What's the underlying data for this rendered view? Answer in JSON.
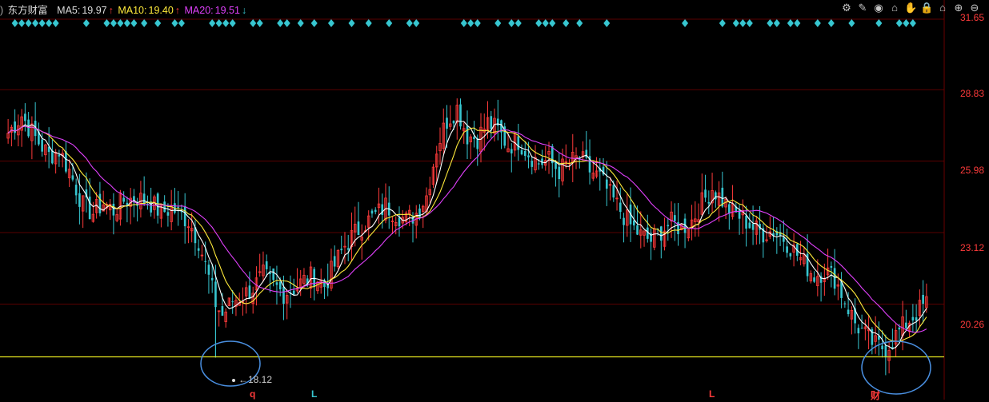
{
  "header": {
    "stock_name": "东方财富",
    "ma5_label": "MA5:",
    "ma5_value": "19.97",
    "ma5_arrow": "↑",
    "ma10_label": "MA10:",
    "ma10_value": "19.40",
    "ma10_arrow": "↑",
    "ma20_label": "MA20:",
    "ma20_value": "19.51",
    "ma20_arrow": "↓"
  },
  "toolbar": {
    "icons": [
      "gear-icon",
      "pencil-icon",
      "eye-icon",
      "basket-icon",
      "hand-icon",
      "lock-icon",
      "home-icon",
      "zoom-in-icon",
      "zoom-out-icon"
    ],
    "glyphs": [
      "⚙",
      "✎",
      "◉",
      "⌂",
      "✋",
      "🔒",
      "⌂",
      "⊕",
      "⊖"
    ]
  },
  "colors": {
    "background": "#000000",
    "up": "#ff3b3b",
    "down": "#37c6d0",
    "ma5": "#ffffff",
    "ma10": "#ffeb3b",
    "ma20": "#e040fb",
    "support_line": "#e8e820",
    "circle": "#4a90e2",
    "grid": "#5a0000"
  },
  "axis": {
    "ticks": [
      "31.65",
      "28.83",
      "25.98",
      "23.12",
      "20.26"
    ]
  },
  "low_annotation": "18.12",
  "event_markers": [
    {
      "label": "q",
      "color": "#ff3b3b"
    },
    {
      "label": "L",
      "color": "#37c6d0"
    },
    {
      "label": "L",
      "color": "#ff3b3b"
    },
    {
      "label": "财",
      "color": "#ff3b3b"
    }
  ],
  "chart_data": {
    "type": "candlestick",
    "ylim": [
      17.4,
      31.65
    ],
    "support_level": 18.12,
    "low_value": 18.12,
    "series": [
      {
        "name": "MA5",
        "last": 19.97
      },
      {
        "name": "MA10",
        "last": 19.4
      },
      {
        "name": "MA20",
        "last": 19.51
      }
    ],
    "price_path": [
      [
        0,
        27.1
      ],
      [
        4,
        27.8
      ],
      [
        8,
        26.9
      ],
      [
        12,
        26.2
      ],
      [
        15,
        26.4
      ],
      [
        18,
        25.6
      ],
      [
        22,
        24.2
      ],
      [
        25,
        23.9
      ],
      [
        28,
        24.3
      ],
      [
        31,
        24.0
      ],
      [
        34,
        24.4
      ],
      [
        38,
        24.5
      ],
      [
        42,
        24.3
      ],
      [
        45,
        23.9
      ],
      [
        48,
        24.1
      ],
      [
        50,
        23.9
      ],
      [
        53,
        23.6
      ],
      [
        56,
        22.8
      ],
      [
        59,
        21.3
      ],
      [
        61,
        20.3
      ],
      [
        63,
        19.8
      ],
      [
        66,
        20.4
      ],
      [
        69,
        20.6
      ],
      [
        72,
        20.9
      ],
      [
        75,
        21.4
      ],
      [
        78,
        21.0
      ],
      [
        81,
        20.7
      ],
      [
        84,
        20.9
      ],
      [
        87,
        21.2
      ],
      [
        90,
        21.4
      ],
      [
        93,
        21.0
      ],
      [
        96,
        21.8
      ],
      [
        99,
        22.6
      ],
      [
        102,
        23.1
      ],
      [
        105,
        23.5
      ],
      [
        108,
        23.8
      ],
      [
        111,
        24.2
      ],
      [
        114,
        23.9
      ],
      [
        117,
        23.6
      ],
      [
        120,
        23.9
      ],
      [
        123,
        24.6
      ],
      [
        126,
        26.5
      ],
      [
        129,
        27.6
      ],
      [
        132,
        28.1
      ],
      [
        135,
        27.0
      ],
      [
        138,
        26.9
      ],
      [
        141,
        27.5
      ],
      [
        144,
        27.2
      ],
      [
        147,
        26.6
      ],
      [
        150,
        26.8
      ],
      [
        153,
        26.3
      ],
      [
        156,
        25.9
      ],
      [
        159,
        26.0
      ],
      [
        162,
        25.6
      ],
      [
        165,
        25.9
      ],
      [
        168,
        26.1
      ],
      [
        171,
        25.6
      ],
      [
        174,
        25.3
      ],
      [
        177,
        24.6
      ],
      [
        180,
        24.0
      ],
      [
        183,
        23.4
      ],
      [
        186,
        23.0
      ],
      [
        189,
        22.8
      ],
      [
        192,
        23.2
      ],
      [
        195,
        23.5
      ],
      [
        198,
        23.3
      ],
      [
        201,
        23.6
      ],
      [
        204,
        24.3
      ],
      [
        207,
        24.9
      ],
      [
        210,
        24.4
      ],
      [
        213,
        23.9
      ],
      [
        216,
        23.7
      ],
      [
        219,
        23.3
      ],
      [
        222,
        23.1
      ],
      [
        225,
        23.2
      ],
      [
        228,
        22.9
      ],
      [
        231,
        22.4
      ],
      [
        234,
        21.9
      ],
      [
        237,
        21.4
      ],
      [
        240,
        21.6
      ],
      [
        243,
        21.3
      ],
      [
        246,
        20.4
      ],
      [
        249,
        19.5
      ],
      [
        252,
        19.0
      ],
      [
        255,
        18.6
      ],
      [
        258,
        18.5
      ],
      [
        261,
        19.0
      ],
      [
        264,
        19.5
      ],
      [
        267,
        19.9
      ],
      [
        270,
        20.3
      ]
    ]
  }
}
